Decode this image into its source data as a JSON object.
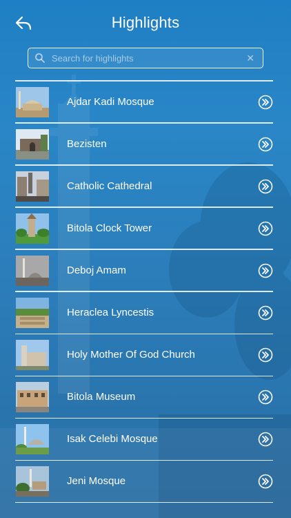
{
  "header": {
    "title": "Highlights",
    "back_icon": "back-arrow-icon"
  },
  "search": {
    "placeholder": "Search for highlights",
    "value": "",
    "search_icon": "search-icon",
    "clear_icon": "clear-icon"
  },
  "colors": {
    "background_top": "#1f7fc4",
    "background_bottom": "#2c6fa4",
    "text": "#ffffff"
  },
  "items": [
    {
      "label": "Ajdar Kadi Mosque"
    },
    {
      "label": "Bezisten"
    },
    {
      "label": "Catholic Cathedral"
    },
    {
      "label": "Bitola Clock Tower"
    },
    {
      "label": "Deboj Amam"
    },
    {
      "label": "Heraclea Lyncestis"
    },
    {
      "label": "Holy Mother Of God Church"
    },
    {
      "label": "Bitola Museum"
    },
    {
      "label": "Isak Celebi Mosque"
    },
    {
      "label": "Jeni Mosque"
    }
  ]
}
